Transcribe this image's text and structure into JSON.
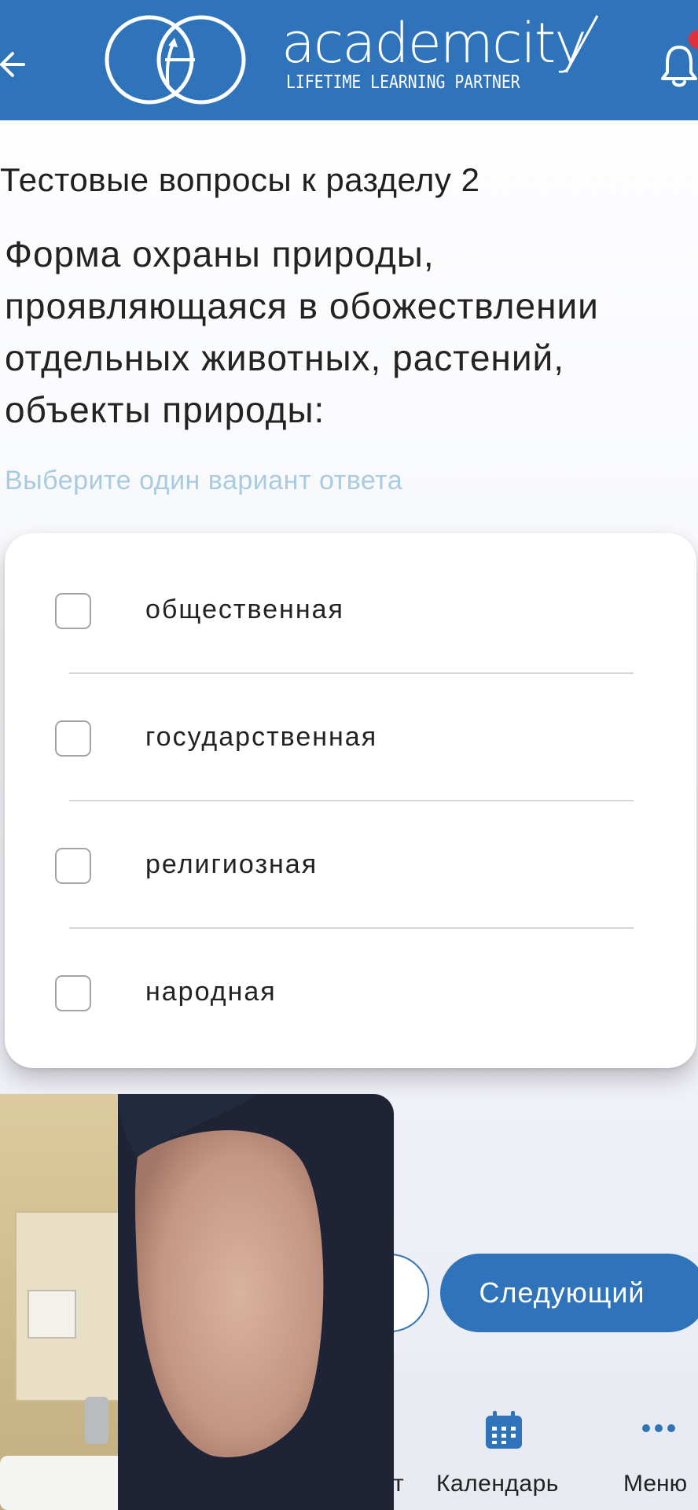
{
  "header": {
    "logo_text": "academcity",
    "tagline": "LIFETIME LEARNING PARTNER"
  },
  "section_title": "Тестовые вопросы к разделу 2",
  "question": "Форма охраны природы, проявляющаяся в обожествлении отдельных животных, растений, объекты природы:",
  "hint": "Выберите один вариант ответа",
  "options": [
    {
      "label": "общественная",
      "checked": false
    },
    {
      "label": "государственная",
      "checked": false
    },
    {
      "label": "религиозная",
      "checked": false
    },
    {
      "label": "народная",
      "checked": false
    }
  ],
  "buttons": {
    "next": "Следующий"
  },
  "nav": {
    "partial_label": "т",
    "calendar": "Календарь",
    "menu": "Меню"
  },
  "colors": {
    "brand": "#2f74bb",
    "hint": "#a9cbe0",
    "notification": "#e0303a"
  }
}
